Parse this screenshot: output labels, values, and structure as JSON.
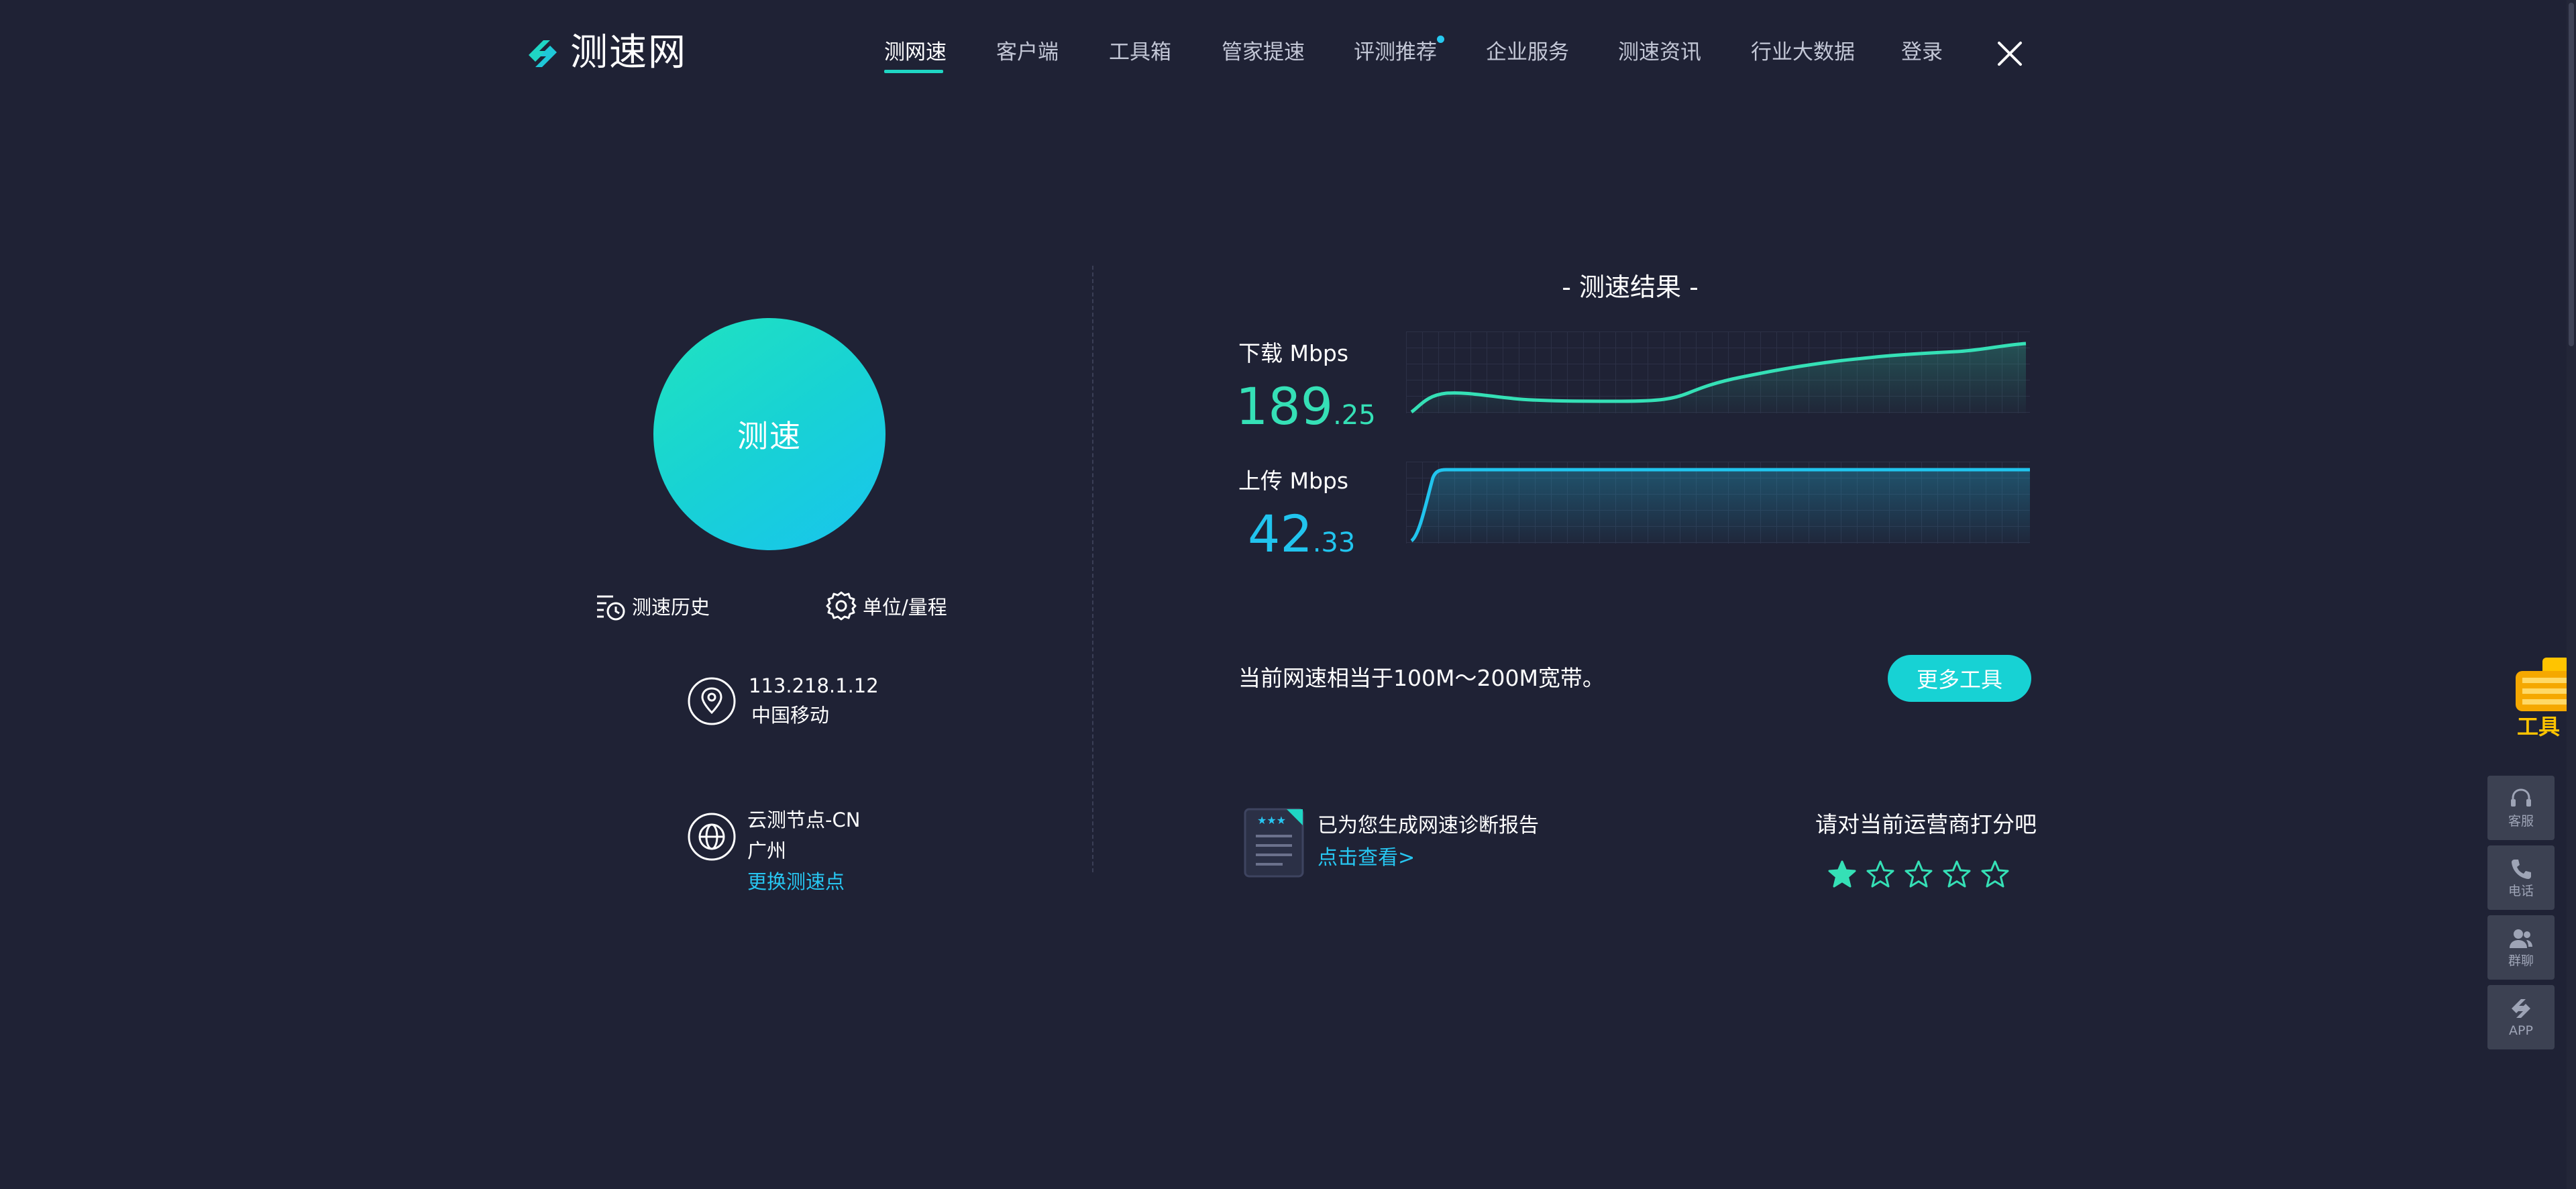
{
  "header": {
    "logo_text": "测速网",
    "nav": [
      {
        "label": "测网速"
      },
      {
        "label": "客户端"
      },
      {
        "label": "工具箱"
      },
      {
        "label": "管家提速"
      },
      {
        "label": "评测推荐"
      },
      {
        "label": "企业服务"
      },
      {
        "label": "测速资讯"
      },
      {
        "label": "行业大数据"
      },
      {
        "label": "登录"
      }
    ]
  },
  "left": {
    "speed_button": "测速",
    "history_label": "测速历史",
    "unit_label": "单位/量程",
    "ip": "113.218.1.12",
    "isp": "中国移动",
    "node_name": "云测节点-CN",
    "node_city": "广州",
    "change_node": "更换测速点"
  },
  "result": {
    "title": "- 测速结果 -",
    "download": {
      "label": "下载 Mbps",
      "int": "189",
      "dec": ".25"
    },
    "upload": {
      "label": "上传 Mbps",
      "int": "42",
      "dec": ".33"
    },
    "broadband_text": "当前网速相当于100M～200M宽带。",
    "more_tools": "更多工具",
    "report_text": "已为您生成网速诊断报告",
    "report_link": "点击查看>",
    "rate_label": "请对当前运营商打分吧",
    "rating": 1,
    "rating_max": 5
  },
  "sidebar": {
    "tool_label": "工具",
    "buttons": [
      {
        "label": "客服",
        "icon": "headset-icon"
      },
      {
        "label": "电话",
        "icon": "phone-icon"
      },
      {
        "label": "群聊",
        "icon": "group-chat-icon"
      },
      {
        "label": "APP",
        "icon": "app-logo-icon"
      }
    ]
  },
  "colors": {
    "background": "#1f2235",
    "accent": "#1fd6c4",
    "download": "#35e0b6",
    "upload": "#21c4ee",
    "link": "#27c6f1"
  }
}
